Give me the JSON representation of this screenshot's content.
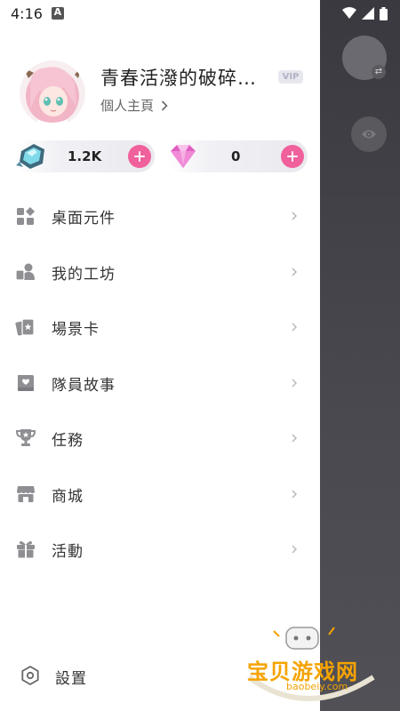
{
  "status_bar": {
    "time": "4:16",
    "notification_icon": "app-notification-icon",
    "icons": [
      "wifi-icon",
      "cell-signal-icon",
      "battery-icon"
    ]
  },
  "profile": {
    "username": "青春活潑的破碎…",
    "vip_label": "VIP",
    "profile_link": "個人主頁"
  },
  "currencies": [
    {
      "icon": "crystal-icon",
      "value": "1.2K"
    },
    {
      "icon": "diamond-icon",
      "value": "0"
    }
  ],
  "menu": {
    "items": [
      {
        "label": "桌面元件",
        "icon": "widgets-icon"
      },
      {
        "label": "我的工坊",
        "icon": "workshop-icon"
      },
      {
        "label": "場景卡",
        "icon": "scene-card-icon"
      },
      {
        "label": "隊員故事",
        "icon": "story-book-icon"
      },
      {
        "label": "任務",
        "icon": "trophy-icon"
      },
      {
        "label": "商城",
        "icon": "store-icon"
      },
      {
        "label": "活動",
        "icon": "gift-icon"
      }
    ]
  },
  "settings": {
    "label": "設置",
    "icon": "settings-icon"
  },
  "watermark": {
    "text": "宝贝游戏网",
    "url": "baobeiy.com"
  },
  "colors": {
    "accent_pink": "#f0609a",
    "icon_gray": "#8e8e93",
    "scrim": "#45444a",
    "watermark": "#f5a300"
  }
}
